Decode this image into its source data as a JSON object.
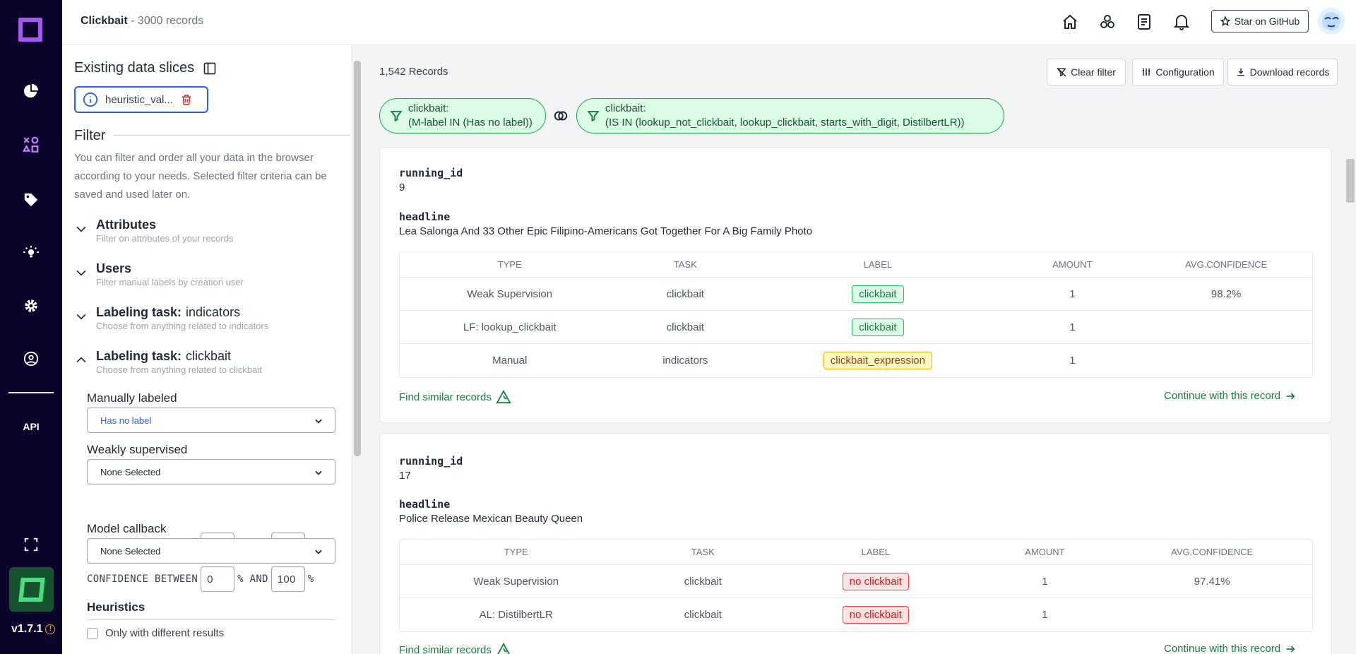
{
  "app": {
    "project_name": "Clickbait",
    "records_suffix": "- 3000 records",
    "version": "v1.7.1",
    "api_label": "API",
    "github_label": "Star on GitHub"
  },
  "sidebar": {
    "slices_title": "Existing data slices",
    "slice_name": "heuristic_val...",
    "filter_title": "Filter",
    "filter_desc": "You can filter and order all your data in the browser according to your needs. Selected filter criteria can be saved and used later on.",
    "sections": [
      {
        "title": "Attributes",
        "subtitle": "Filter on attributes of your records"
      },
      {
        "title": "Users",
        "subtitle": "Filter manual labels by creation user"
      },
      {
        "title": "Labeling task:",
        "name": "indicators",
        "subtitle": "Choose from anything related to indicators"
      },
      {
        "title": "Labeling task:",
        "name": "clickbait",
        "subtitle": "Choose from anything related to clickbait"
      }
    ],
    "manually_labeled": {
      "label": "Manually labeled",
      "value": "Has no label"
    },
    "weakly_supervised": {
      "label": "Weakly supervised",
      "value": "None Selected"
    },
    "model_callback": {
      "label": "Model callback",
      "value": "None Selected"
    },
    "confidence": {
      "between": "CONFIDENCE BETWEEN",
      "pct": "%",
      "and": "AND",
      "min": "0",
      "max": "100"
    },
    "heuristics": {
      "label": "Heuristics",
      "only_different": "Only with different results"
    }
  },
  "main": {
    "records_count": "1,542 Records",
    "clear_filter": "Clear filter",
    "configuration": "Configuration",
    "download": "Download records",
    "filters": [
      {
        "task": "clickbait:",
        "expr": "(M-label IN (Has no label))"
      },
      {
        "task": "clickbait:",
        "expr": "(IS IN (lookup_not_clickbait, lookup_clickbait, starts_with_digit, DistilbertLR))"
      }
    ],
    "columns": [
      "TYPE",
      "TASK",
      "LABEL",
      "AMOUNT",
      "AVG.CONFIDENCE"
    ],
    "find_similar": "Find similar records",
    "continue": "Continue with this record",
    "records": [
      {
        "id_label": "running_id",
        "id": "9",
        "headline_label": "headline",
        "headline": "Lea Salonga And 33 Other Epic Filipino-Americans Got Together For A Big Family Photo",
        "rows": [
          {
            "type": "Weak Supervision",
            "task": "clickbait",
            "label": "clickbait",
            "amount": "1",
            "conf": "98.2%"
          },
          {
            "type": "LF: lookup_clickbait",
            "task": "clickbait",
            "label": "clickbait",
            "amount": "1",
            "conf": ""
          },
          {
            "type": "Manual",
            "task": "indicators",
            "label": "clickbait_expression",
            "amount": "1",
            "conf": ""
          }
        ]
      },
      {
        "id_label": "running_id",
        "id": "17",
        "headline_label": "headline",
        "headline": "Police Release Mexican Beauty Queen",
        "rows": [
          {
            "type": "Weak Supervision",
            "task": "clickbait",
            "label": "no clickbait",
            "amount": "1",
            "conf": "97.41%"
          },
          {
            "type": "AL: DistilbertLR",
            "task": "clickbait",
            "label": "no clickbait",
            "amount": "1",
            "conf": ""
          }
        ]
      }
    ]
  }
}
